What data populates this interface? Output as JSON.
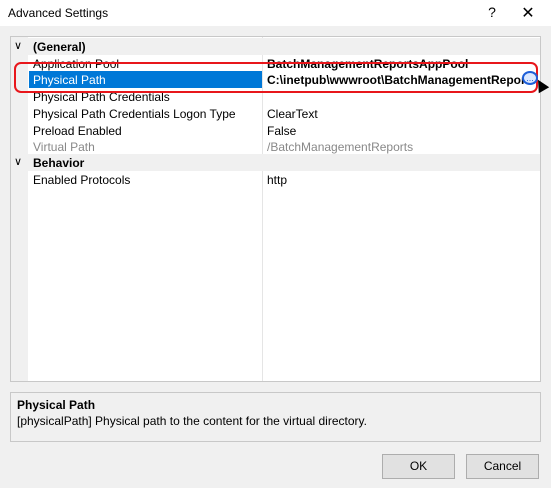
{
  "window": {
    "title": "Advanced Settings",
    "help": "?",
    "close": "✕"
  },
  "categories": {
    "general": {
      "toggle": "∨",
      "label": "(General)"
    },
    "behavior": {
      "toggle": "∨",
      "label": "Behavior"
    }
  },
  "properties": {
    "app_pool": {
      "name": "Application Pool",
      "value": "BatchManagementReportsAppPool"
    },
    "physical_path": {
      "name": "Physical Path",
      "value": "C:\\inetpub\\wwwroot\\BatchManagementReports",
      "ellipsis": "..."
    },
    "credentials": {
      "name": "Physical Path Credentials",
      "value": ""
    },
    "logon_type": {
      "name": "Physical Path Credentials Logon Type",
      "value": "ClearText"
    },
    "preload": {
      "name": "Preload Enabled",
      "value": "False"
    },
    "virtual_path": {
      "name": "Virtual Path",
      "value": "/BatchManagementReports"
    },
    "protocols": {
      "name": "Enabled Protocols",
      "value": "http"
    }
  },
  "description": {
    "title": "Physical Path",
    "text": "[physicalPath] Physical path to the content for the virtual directory."
  },
  "buttons": {
    "ok": "OK",
    "cancel": "Cancel"
  },
  "colors": {
    "selection": "#0078d7",
    "highlight_border": "#e8161b"
  }
}
